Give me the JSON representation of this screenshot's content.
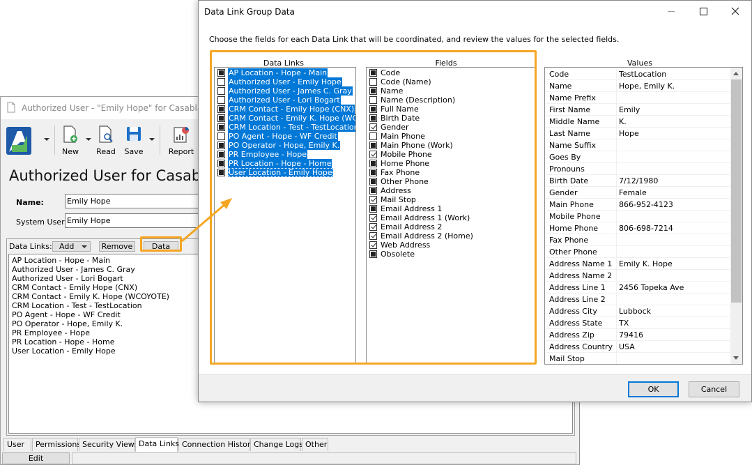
{
  "background_window": {
    "title": "Authorized User - \"Emily Hope\" for Casablanca",
    "toolbar": {
      "new_label": "New",
      "read_label": "Read",
      "save_label": "Save",
      "report_label": "Report"
    },
    "page_title": "Authorized User for Casablan",
    "name_label": "Name:",
    "name_value": "Emily Hope",
    "system_user_label": "System User:",
    "system_user_value": "Emily Hope",
    "data_links_label": "Data Links:",
    "add_label": "Add",
    "remove_label": "Remove",
    "data_label": "Data",
    "data_links": [
      "AP Location - Hope  - Main",
      "Authorized User - James C. Gray",
      "Authorized User - Lori Bogart",
      "CRM Contact - Emily Hope (CNX)",
      "CRM Contact - Emily K. Hope (WCOYOTE)",
      "CRM Location - Test - TestLocation",
      "PO Agent - Hope - WF Credit",
      "PO Operator - Hope, Emily K.",
      "PR Employee - Hope",
      "PR Location - Hope - Home",
      "User Location - Emily Hope"
    ],
    "tabs": [
      "User",
      "Permissions",
      "Security Views",
      "Data Links",
      "Connection History",
      "Change Logs",
      "Other"
    ],
    "active_tab": "Data Links",
    "edit_label": "Edit"
  },
  "dialog": {
    "title": "Data Link Group Data",
    "instructions": "Choose the fields for each Data Link that will be coordinated, and review the values for the selected fields.",
    "data_links_header": "Data Links",
    "fields_header": "Fields",
    "values_header": "Values",
    "data_links": [
      {
        "label": "AP Location - Hope  - Main",
        "check": "indeterminate",
        "selected": true
      },
      {
        "label": "Authorized User - Emily Hope",
        "check": "none",
        "selected": true
      },
      {
        "label": "Authorized User - James C. Gray",
        "check": "none",
        "selected": true
      },
      {
        "label": "Authorized User - Lori Bogart",
        "check": "none",
        "selected": true
      },
      {
        "label": "CRM Contact - Emily Hope (CNX)",
        "check": "indeterminate",
        "selected": true
      },
      {
        "label": "CRM Contact - Emily K. Hope (WCOYOTE)",
        "check": "indeterminate",
        "selected": true
      },
      {
        "label": "CRM Location - Test - TestLocation",
        "check": "indeterminate",
        "selected": true
      },
      {
        "label": "PO Agent - Hope - WF Credit",
        "check": "none",
        "selected": true
      },
      {
        "label": "PO Operator - Hope, Emily K.",
        "check": "indeterminate",
        "selected": true
      },
      {
        "label": "PR Employee - Hope",
        "check": "indeterminate",
        "selected": true
      },
      {
        "label": "PR Location - Hope - Home",
        "check": "indeterminate",
        "selected": true
      },
      {
        "label": "User Location - Emily Hope",
        "check": "indeterminate",
        "selected": true
      }
    ],
    "fields": [
      {
        "label": "Code",
        "check": "indeterminate"
      },
      {
        "label": "Code (Name)",
        "check": "none"
      },
      {
        "label": "Name",
        "check": "indeterminate"
      },
      {
        "label": "Name (Description)",
        "check": "none"
      },
      {
        "label": "Full Name",
        "check": "indeterminate"
      },
      {
        "label": "Birth Date",
        "check": "indeterminate"
      },
      {
        "label": "Gender",
        "check": "checked"
      },
      {
        "label": "Main Phone",
        "check": "none"
      },
      {
        "label": "Main Phone (Work)",
        "check": "indeterminate"
      },
      {
        "label": "Mobile Phone",
        "check": "checked"
      },
      {
        "label": "Home Phone",
        "check": "indeterminate"
      },
      {
        "label": "Fax Phone",
        "check": "indeterminate"
      },
      {
        "label": "Other Phone",
        "check": "indeterminate"
      },
      {
        "label": "Address",
        "check": "indeterminate"
      },
      {
        "label": "Mail Stop",
        "check": "checked"
      },
      {
        "label": "Email Address 1",
        "check": "indeterminate"
      },
      {
        "label": "Email Address 1 (Work)",
        "check": "checked"
      },
      {
        "label": "Email Address 2",
        "check": "checked"
      },
      {
        "label": "Email Address 2 (Home)",
        "check": "checked"
      },
      {
        "label": "Web Address",
        "check": "checked"
      },
      {
        "label": "Obsolete",
        "check": "indeterminate"
      }
    ],
    "values": [
      {
        "key": "Code",
        "value": "TestLocation"
      },
      {
        "key": "Name",
        "value": "Hope, Emily K."
      },
      {
        "key": "Name Prefix",
        "value": ""
      },
      {
        "key": "First Name",
        "value": "Emily"
      },
      {
        "key": "Middle Name",
        "value": "K."
      },
      {
        "key": "Last Name",
        "value": "Hope"
      },
      {
        "key": "Name Suffix",
        "value": ""
      },
      {
        "key": "Goes By",
        "value": ""
      },
      {
        "key": "Pronouns",
        "value": ""
      },
      {
        "key": "Birth Date",
        "value": "7/12/1980"
      },
      {
        "key": "Gender",
        "value": "Female"
      },
      {
        "key": "Main Phone",
        "value": "866-952-4123"
      },
      {
        "key": "Mobile Phone",
        "value": ""
      },
      {
        "key": "Home Phone",
        "value": "806-698-7214"
      },
      {
        "key": "Fax Phone",
        "value": ""
      },
      {
        "key": "Other Phone",
        "value": ""
      },
      {
        "key": "Address Name 1",
        "value": "Emily K. Hope"
      },
      {
        "key": "Address Name 2",
        "value": ""
      },
      {
        "key": "Address Line 1",
        "value": "2456 Topeka Ave"
      },
      {
        "key": "Address Line 2",
        "value": ""
      },
      {
        "key": "Address City",
        "value": "Lubbock"
      },
      {
        "key": "Address State",
        "value": "TX"
      },
      {
        "key": "Address Zip",
        "value": "79416"
      },
      {
        "key": "Address Country",
        "value": "USA"
      },
      {
        "key": "Mail Stop",
        "value": ""
      }
    ],
    "ok_label": "OK",
    "cancel_label": "Cancel"
  },
  "colors": {
    "accent": "#0078d7",
    "highlight": "#f5a623"
  }
}
